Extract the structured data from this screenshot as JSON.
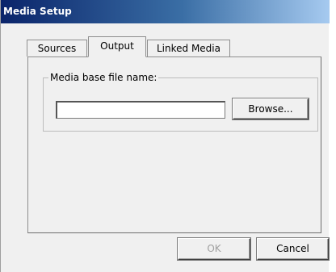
{
  "window": {
    "title": "Media Setup"
  },
  "tabs": [
    {
      "label": "Sources",
      "selected": false
    },
    {
      "label": "Output",
      "selected": true
    },
    {
      "label": "Linked Media",
      "selected": false
    }
  ],
  "output_tab": {
    "group_label": "Media base file name:",
    "file_name_value": "",
    "browse_label": "Browse..."
  },
  "footer": {
    "ok_label": "OK",
    "ok_enabled": false,
    "cancel_label": "Cancel"
  },
  "colors": {
    "titlebar_start": "#0a246a",
    "titlebar_end": "#a6caf0",
    "dialog_bg": "#f0f0f0",
    "disabled_text": "#a0a0a0"
  }
}
